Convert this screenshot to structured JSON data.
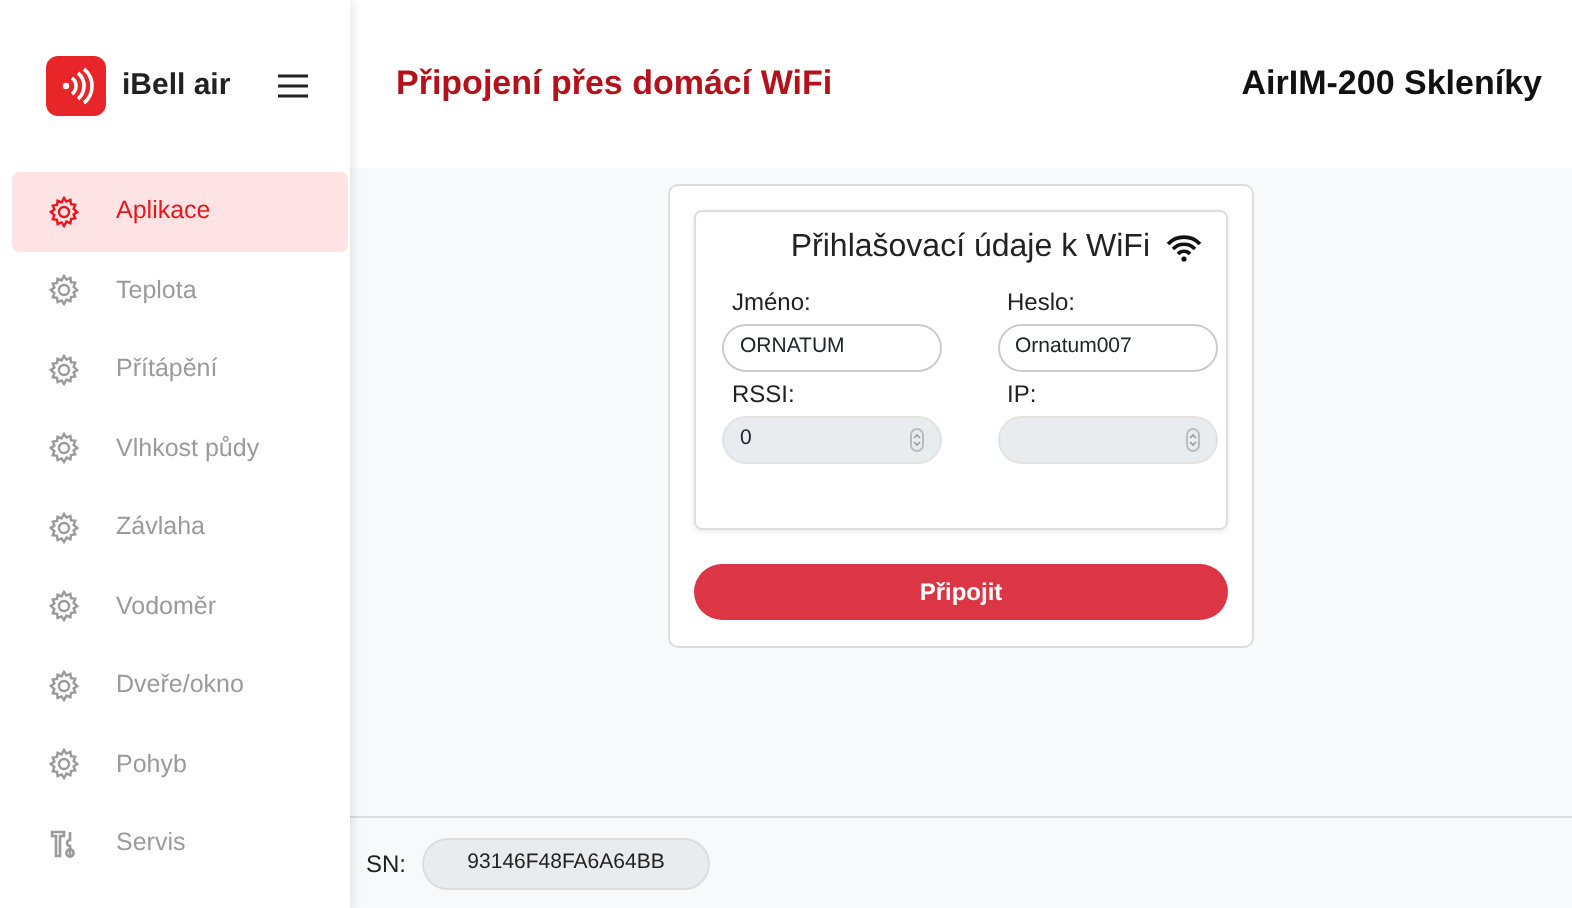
{
  "brand": {
    "name": "iBell air"
  },
  "sidebar": {
    "items": [
      {
        "label": "Aplikace",
        "kind": "gear",
        "selected": true
      },
      {
        "label": "Teplota",
        "kind": "gear",
        "selected": false
      },
      {
        "label": "Přítápění",
        "kind": "gear",
        "selected": false
      },
      {
        "label": "Vlhkost půdy",
        "kind": "gear",
        "selected": false
      },
      {
        "label": "Závlaha",
        "kind": "gear",
        "selected": false
      },
      {
        "label": "Vodoměr",
        "kind": "gear",
        "selected": false
      },
      {
        "label": "Dveře/okno",
        "kind": "gear",
        "selected": false
      },
      {
        "label": "Pohyb",
        "kind": "gear",
        "selected": false
      },
      {
        "label": "Servis",
        "kind": "tools",
        "selected": false
      }
    ]
  },
  "header": {
    "title": "Připojení přes domácí WiFi",
    "device": "AirIM-200 Skleníky"
  },
  "wifi_card": {
    "title": "Přihlašovací údaje k WiFi",
    "fields": [
      {
        "label": "Jméno:",
        "value": "ORNATUM",
        "kind": "text",
        "disabled": false
      },
      {
        "label": "Heslo:",
        "value": "Ornatum007",
        "kind": "text",
        "disabled": false
      },
      {
        "label": "RSSI:",
        "value": "0",
        "kind": "number",
        "disabled": true
      },
      {
        "label": "IP:",
        "kind": "number",
        "disabled": true
      }
    ]
  },
  "connect_button": "Připojit",
  "footer": {
    "label": "SN:",
    "value": "93146F48FA6A64BB"
  }
}
